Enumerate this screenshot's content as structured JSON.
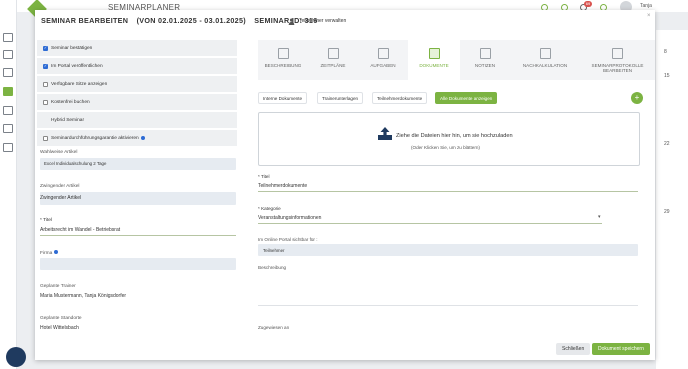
{
  "app": {
    "title": "SEMINARPLANER",
    "badge_count": "69",
    "user_short": "Tanja"
  },
  "calendar": {
    "numbers": [
      "8",
      "15",
      "22",
      "29"
    ]
  },
  "modal": {
    "title_main": "SEMINAR BEARBEITEN",
    "title_dates": "(VON 02.01.2025 - 03.01.2025)",
    "title_id": "SEMINAR ID: 316",
    "participants_button": "Teilnehmer verwalten",
    "left": {
      "checkboxes": [
        {
          "label": "Seminar bestätigen",
          "checked": true
        },
        {
          "label": "Im Portal veröffentlichen",
          "checked": true
        },
        {
          "label": "Verfügbare Sitze anzeigen",
          "checked": false
        },
        {
          "label": "Kostenfrei buchen",
          "checked": false
        },
        {
          "label": "Hybrid Seminar",
          "checked": false
        },
        {
          "label": "Seminardurchführungsgarantie aktivieren",
          "checked": false
        }
      ],
      "optional_article_label": "Wahlweise Artikel",
      "optional_article_tag": "Excel Individualschulung 2 Tage",
      "mandatory_article_label": "Zwingender Artikel",
      "mandatory_article_value": "Zwingender Artikel",
      "title_label": "* Titel",
      "title_value": "Arbeitsrecht im Wandel - Betriebsrat",
      "company_label": "Firma",
      "trainer_label": "Geplante Trainer",
      "trainer_value": "Maria Mustermann, Tanja Königsdorfer",
      "location_label": "Geplante Standorte",
      "location_value": "Hotel Wittelsbach"
    },
    "tabs": [
      {
        "label": "BESCHREIBUNG"
      },
      {
        "label": "ZEITPLÄNE"
      },
      {
        "label": "AUFGABEN"
      },
      {
        "label": "DOKUMENTE"
      },
      {
        "label": "NOTIZEN"
      },
      {
        "label": "NACHKALKULATION"
      },
      {
        "label": "SEMINARPROTOKOLLE BEARBEITEN"
      }
    ],
    "active_tab": "DOKUMENTE",
    "doc_filters": [
      "Interne Dokumente",
      "Trainerunterlagen",
      "Teilnehmerdokumente",
      "Alle Dokumente anzeigen"
    ],
    "dropzone_main": "Ziehe die Dateien hier hin, um sie hochzuladen",
    "dropzone_sub": "(Oder Klicken Sie, um zu blättern)",
    "doc_title_label": "* Titel",
    "doc_title_value": "Teilnehmerdokumente",
    "category_label": "* Kategorie",
    "category_value": "Veranstaltungsinformationen",
    "portal_label": "Im Online Portal sichtbar für :",
    "portal_tag": "Teilnehmer",
    "description_label": "Beschreibung",
    "assigned_label": "Zugewiesen an",
    "close_button": "Schließen",
    "save_button": "Dokument speichern"
  },
  "colors": {
    "accent": "#7cb342",
    "checkbox": "#2d6bd4",
    "field_bg": "#e6ebf1"
  }
}
